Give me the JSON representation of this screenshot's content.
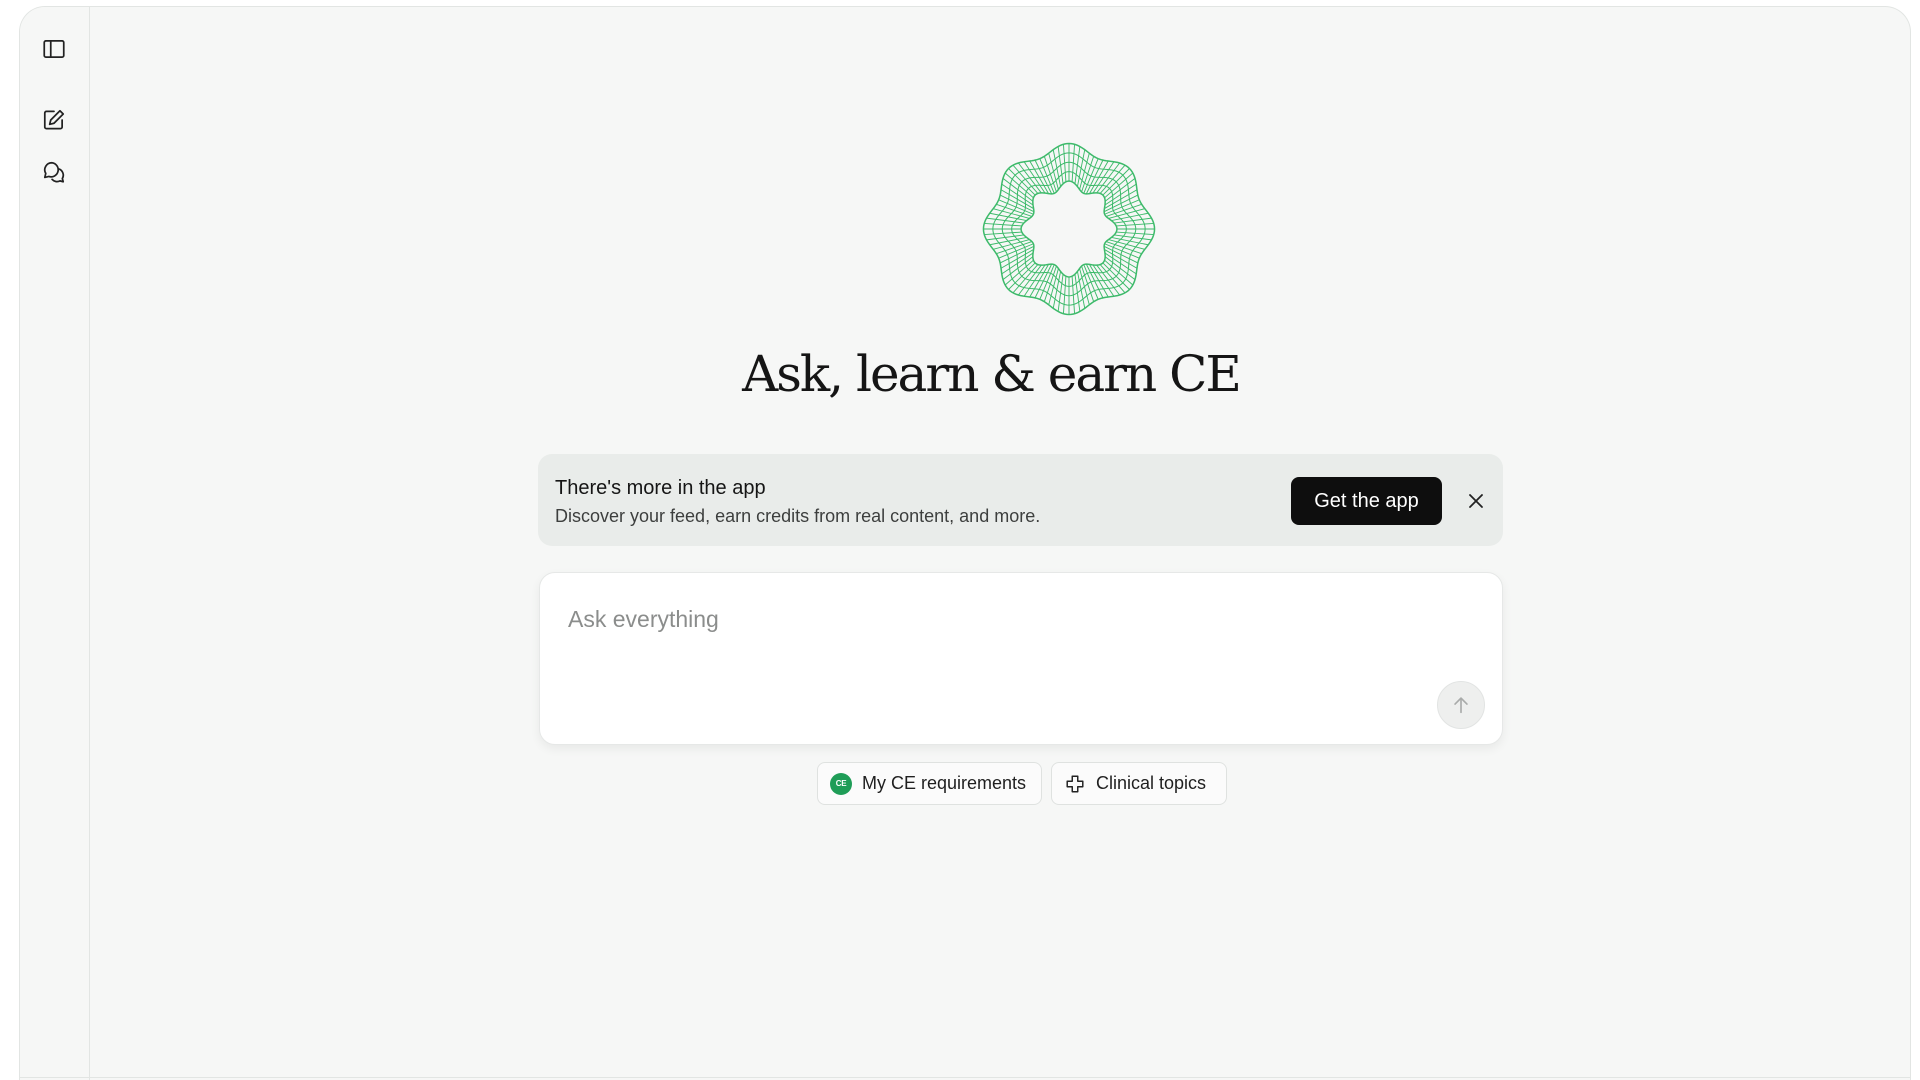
{
  "sidebar": {
    "items": [
      {
        "icon": "sidebar-toggle-icon"
      },
      {
        "icon": "new-chat-icon"
      },
      {
        "icon": "chats-icon"
      }
    ]
  },
  "hero": {
    "logo_icon": "wireframe-ring-logo",
    "title": "Ask, learn & earn CE"
  },
  "banner": {
    "title": "There's more in the app",
    "subtitle": "Discover your feed, earn credits from real content, and more.",
    "cta_label": "Get the app",
    "close_icon": "close-icon"
  },
  "ask": {
    "placeholder": "Ask everything",
    "value": "",
    "send_icon": "arrow-up-icon"
  },
  "chips": [
    {
      "label": "My CE requirements",
      "icon": "ce-badge-icon",
      "badge_text": "CE"
    },
    {
      "label": "Clinical topics",
      "icon": "medical-cross-icon"
    }
  ],
  "colors": {
    "accent_green": "#1f9d57",
    "logo_green": "#3dba6a",
    "cta_background": "#0e0e0e",
    "banner_background": "#e9ecea",
    "page_background": "#f6f7f6"
  }
}
